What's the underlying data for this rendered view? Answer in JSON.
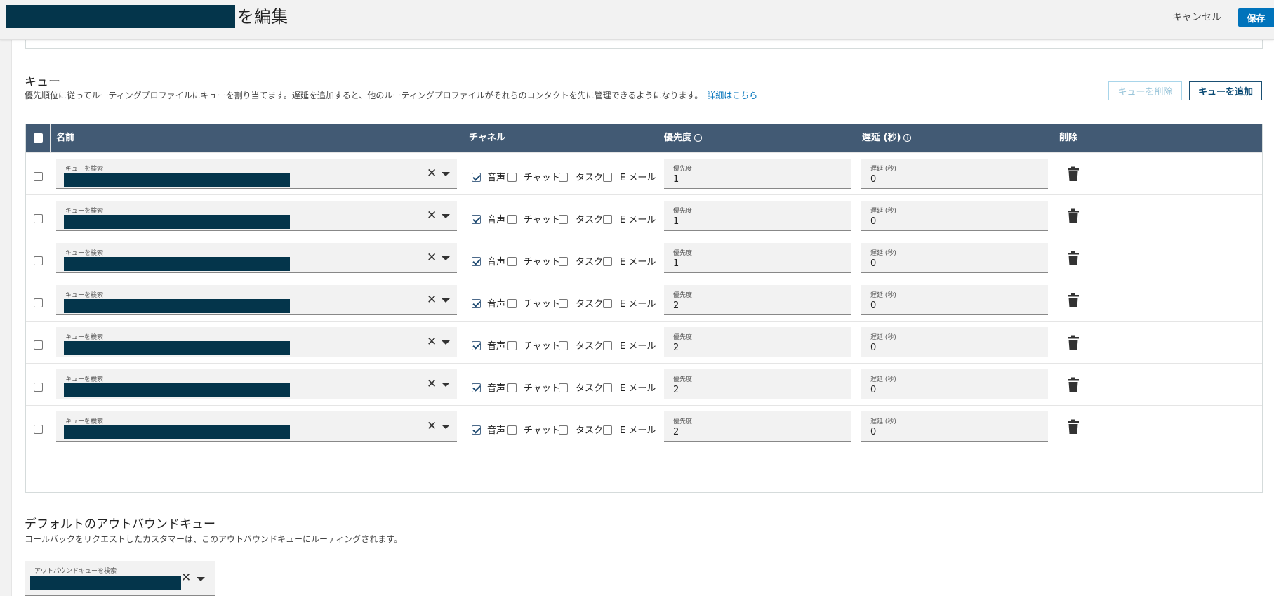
{
  "header": {
    "title_suffix": "を編集",
    "cancel_label": "キャンセル",
    "save_label": "保存"
  },
  "queues": {
    "title": "キュー",
    "description": "優先順位に従ってルーティングプロファイルにキューを割り当てます。遅延を追加すると、他のルーティングプロファイルがそれらのコンタクトを先に管理できるようになります。",
    "details_link": "詳細はこちら",
    "remove_button": "キューを削除",
    "add_button": "キューを追加",
    "columns": {
      "name": "名前",
      "channel": "チャネル",
      "priority": "優先度",
      "delay": "遅延 (秒)",
      "delete": "削除"
    },
    "field_labels": {
      "search": "キューを検索",
      "priority": "優先度",
      "delay": "遅延 (秒)"
    },
    "channel_labels": [
      "音声",
      "チャット",
      "タスク",
      "E メール"
    ],
    "rows": [
      {
        "priority": "1",
        "delay": "0",
        "channels": [
          true,
          false,
          false,
          false
        ]
      },
      {
        "priority": "1",
        "delay": "0",
        "channels": [
          true,
          false,
          false,
          false
        ]
      },
      {
        "priority": "1",
        "delay": "0",
        "channels": [
          true,
          false,
          false,
          false
        ]
      },
      {
        "priority": "2",
        "delay": "0",
        "channels": [
          true,
          false,
          false,
          false
        ]
      },
      {
        "priority": "2",
        "delay": "0",
        "channels": [
          true,
          false,
          false,
          false
        ]
      },
      {
        "priority": "2",
        "delay": "0",
        "channels": [
          true,
          false,
          false,
          false
        ]
      },
      {
        "priority": "2",
        "delay": "0",
        "channels": [
          true,
          false,
          false,
          false
        ]
      }
    ]
  },
  "outbound": {
    "title": "デフォルトのアウトバウンドキュー",
    "description": "コールバックをリクエストしたカスタマーは、このアウトバウンドキューにルーティングされます。",
    "search_label": "アウトバウンドキューを検索"
  },
  "colors": {
    "header_bg": "#425a74",
    "redaction": "#04354b",
    "primary": "#0073bb"
  }
}
